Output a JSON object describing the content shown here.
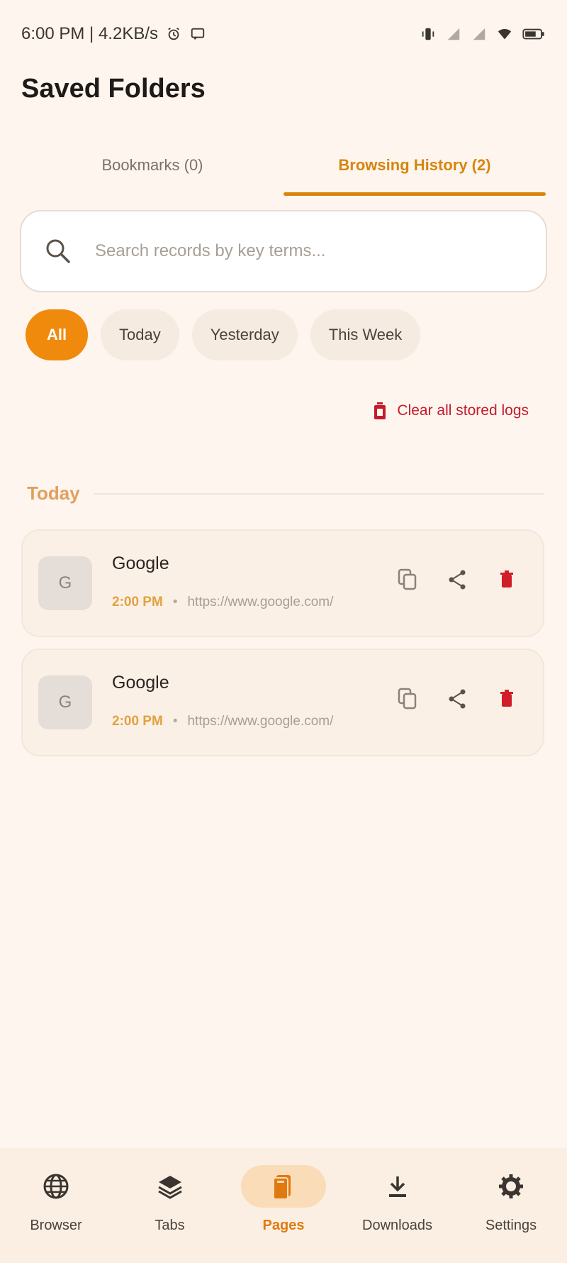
{
  "status_bar": {
    "left_text": "6:00 PM | 4.2KB/s",
    "icons": [
      "alarm-icon",
      "message-icon",
      "vibrate-icon",
      "signal-icon",
      "signal-icon",
      "wifi-icon",
      "battery-icon"
    ]
  },
  "header": {
    "title": "Saved Folders"
  },
  "tabs": [
    {
      "label": "Bookmarks (0)",
      "active": false
    },
    {
      "label": "Browsing History (2)",
      "active": true
    }
  ],
  "search": {
    "placeholder": "Search records by key terms...",
    "value": ""
  },
  "filters": [
    {
      "label": "All",
      "active": true
    },
    {
      "label": "Today",
      "active": false
    },
    {
      "label": "Yesterday",
      "active": false
    },
    {
      "label": "This Week",
      "active": false
    }
  ],
  "clear_logs": {
    "label": "Clear all stored logs"
  },
  "section": {
    "label": "Today"
  },
  "history": [
    {
      "favicon_letter": "G",
      "title": "Google",
      "time": "2:00 PM",
      "separator": "•",
      "url": "https://www.google.com/"
    },
    {
      "favicon_letter": "G",
      "title": "Google",
      "time": "2:00 PM",
      "separator": "•",
      "url": "https://www.google.com/"
    }
  ],
  "bottom_nav": [
    {
      "label": "Browser",
      "icon": "globe-icon",
      "active": false
    },
    {
      "label": "Tabs",
      "icon": "layers-icon",
      "active": false
    },
    {
      "label": "Pages",
      "icon": "book-icon",
      "active": true
    },
    {
      "label": "Downloads",
      "icon": "download-icon",
      "active": false
    },
    {
      "label": "Settings",
      "icon": "gear-icon",
      "active": false
    }
  ],
  "colors": {
    "background": "#fdf5ee",
    "accent": "#f08a0c",
    "tab_accent": "#d8850d",
    "danger": "#c61a2b",
    "timestamp": "#e2a240"
  }
}
